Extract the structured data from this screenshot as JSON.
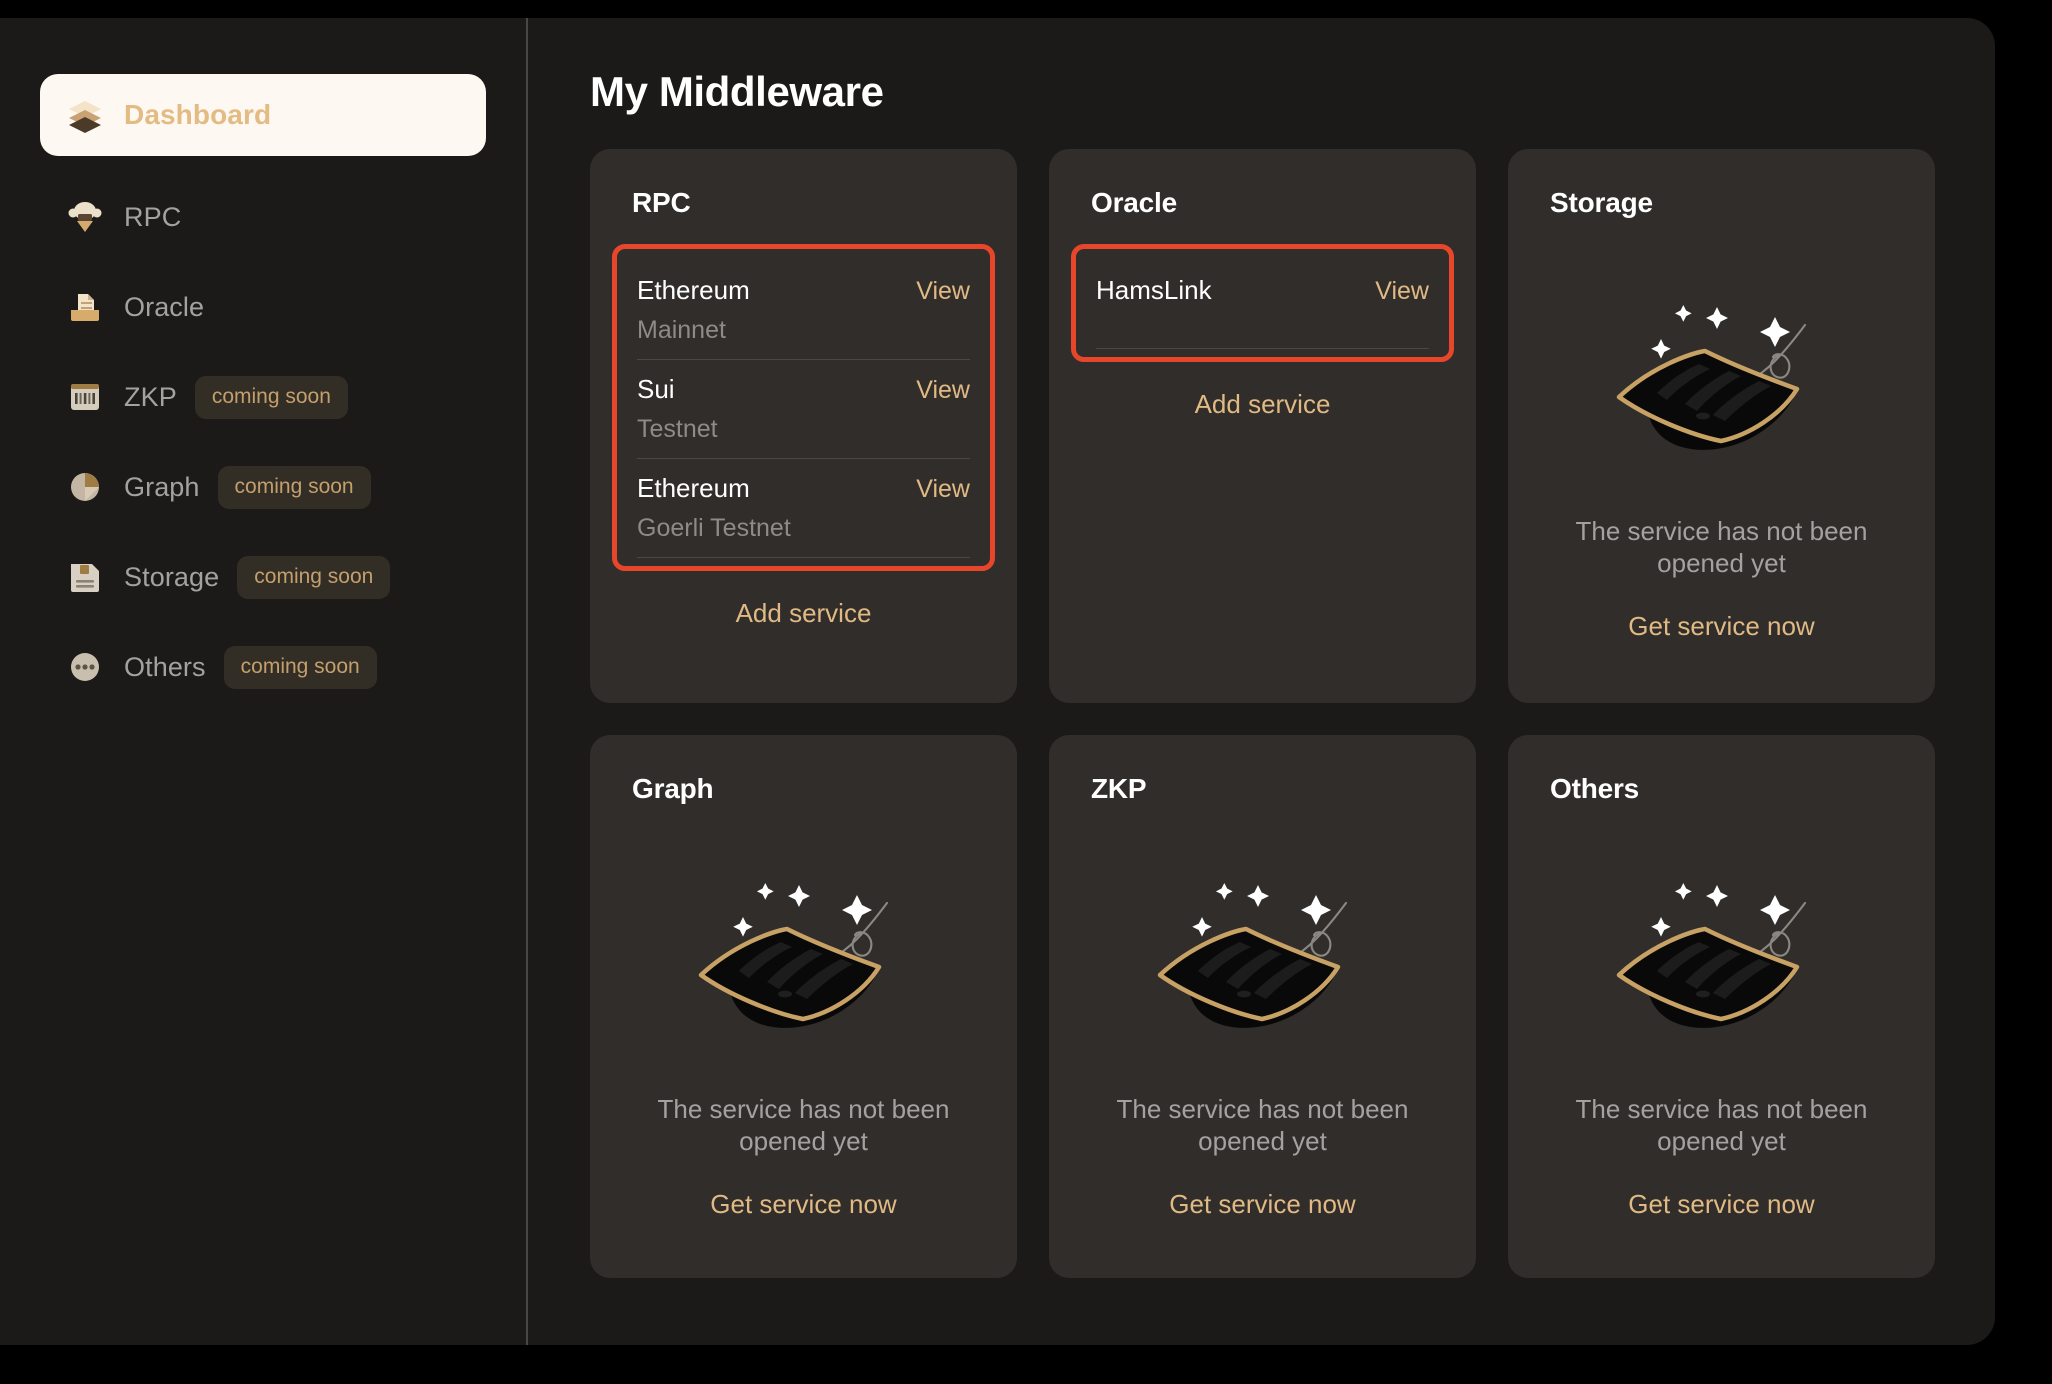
{
  "colors": {
    "accent_gold": "#E0B984",
    "highlight_red": "#E8462A",
    "card_bg": "#302D2A",
    "panel_bg": "#1B1A19",
    "active_nav_bg": "#FDF9F2",
    "muted_text": "#A3A2A1"
  },
  "sidebar": {
    "items": [
      {
        "label": "Dashboard",
        "icon": "layers-icon",
        "active": true,
        "badge": null
      },
      {
        "label": "RPC",
        "icon": "rpc-node-icon",
        "active": false,
        "badge": null
      },
      {
        "label": "Oracle",
        "icon": "document-tray-icon",
        "active": false,
        "badge": null
      },
      {
        "label": "ZKP",
        "icon": "barcode-icon",
        "active": false,
        "badge": "coming soon"
      },
      {
        "label": "Graph",
        "icon": "pie-chart-icon",
        "active": false,
        "badge": "coming soon"
      },
      {
        "label": "Storage",
        "icon": "floppy-disk-icon",
        "active": false,
        "badge": "coming soon"
      },
      {
        "label": "Others",
        "icon": "ellipsis-circle-icon",
        "active": false,
        "badge": "coming soon"
      }
    ]
  },
  "main": {
    "page_title": "My Middleware",
    "cards": [
      {
        "title": "RPC",
        "state": "has-services",
        "highlighted": true,
        "services": [
          {
            "name": "Ethereum",
            "network": "Mainnet",
            "action": "View"
          },
          {
            "name": "Sui",
            "network": "Testnet",
            "action": "View"
          },
          {
            "name": "Ethereum",
            "network": "Goerli Testnet",
            "action": "View"
          }
        ],
        "add_label": "Add service"
      },
      {
        "title": "Oracle",
        "state": "has-services",
        "highlighted": true,
        "services": [
          {
            "name": "HamsLink",
            "network": "",
            "action": "View"
          }
        ],
        "add_label": "Add service"
      },
      {
        "title": "Storage",
        "state": "empty",
        "empty_message": "The service has not been opened yet",
        "cta_label": "Get service now"
      },
      {
        "title": "Graph",
        "state": "empty",
        "empty_message": "The service has not been opened yet",
        "cta_label": "Get service now"
      },
      {
        "title": "ZKP",
        "state": "empty",
        "empty_message": "The service has not been opened yet",
        "cta_label": "Get service now"
      },
      {
        "title": "Others",
        "state": "empty",
        "empty_message": "The service has not been opened yet",
        "cta_label": "Get service now"
      }
    ]
  }
}
